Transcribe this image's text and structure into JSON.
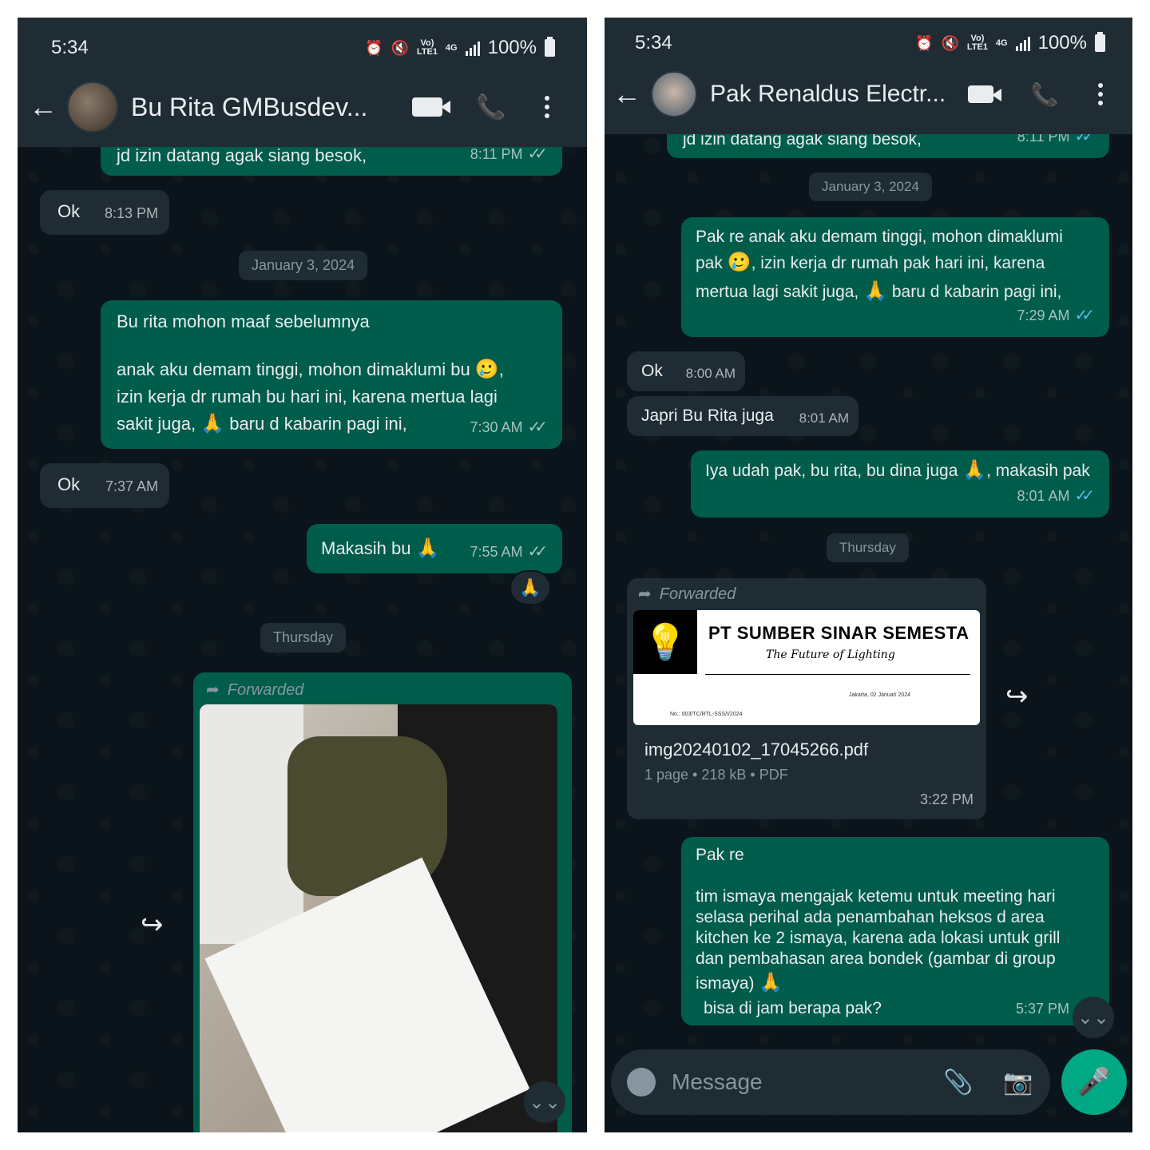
{
  "left": {
    "status_time": "5:34",
    "status_battery": "100%",
    "status_net": "4G",
    "status_volte": "Vo) LTE1",
    "contact_name": "Bu Rita GMBusdev...",
    "messages": {
      "m1_text": "jd izin datang agak siang besok,",
      "m1_time": "8:11 PM",
      "m2_text": "Ok",
      "m2_time": "8:13 PM",
      "date1": "January 3, 2024",
      "m3_line1": "Bu rita mohon maaf sebelumnya",
      "m3_line2a": "anak aku demam tinggi, mohon dimaklumi bu",
      "m3_line3": "izin kerja dr rumah bu hari ini, karena mertua lagi",
      "m3_line4a": "sakit juga,",
      "m3_line4b": "baru d kabarin pagi ini,",
      "m3_time": "7:30 AM",
      "m4_text": "Ok",
      "m4_time": "7:37 AM",
      "m5_text": "Makasih bu",
      "m5_time": "7:55 AM",
      "date2": "Thursday",
      "forwarded": "Forwarded"
    }
  },
  "right": {
    "status_time": "5:34",
    "status_battery": "100%",
    "status_net": "4G",
    "status_volte": "Vo) LTE1",
    "contact_name": "Pak Renaldus Electr...",
    "messages": {
      "m1_text": "jd izin datang agak siang besok,",
      "m1_time": "8:11 PM",
      "date1": "January 3, 2024",
      "m2_line1": "Pak re anak aku demam tinggi, mohon dimaklumi",
      "m2_line2a": "pak",
      "m2_line2b": ", izin kerja dr rumah pak hari ini, karena",
      "m2_line3a": "mertua lagi sakit juga,",
      "m2_line3b": "baru d kabarin pagi ini,",
      "m2_time": "7:29 AM",
      "m3_text": "Ok",
      "m3_time": "8:00 AM",
      "m4_text": "Japri Bu Rita juga",
      "m4_time": "8:01 AM",
      "m5_text_a": "Iya udah pak, bu rita, bu dina juga",
      "m5_text_b": ", makasih pak",
      "m5_time": "8:01 AM",
      "date2": "Thursday",
      "forwarded": "Forwarded",
      "doc_company": "PT SUMBER SINAR SEMESTA",
      "doc_tagline": "The Future of Lighting",
      "doc_place_date": "Jakarta, 02 Januari 2024",
      "doc_number": "No.: 003/TC/RTL-SSS/I/2024",
      "doc_filename": "img20240102_17045266.pdf",
      "doc_meta": "1 page • 218 kB • PDF",
      "doc_time": "3:22 PM",
      "m6_line1": "Pak re",
      "m6_line2": "tim ismaya mengajak ketemu untuk  meeting  hari",
      "m6_line3": "selasa perihal ada penambahan heksos d area",
      "m6_line4": "kitchen ke 2 ismaya, karena ada lokasi untuk grill",
      "m6_line5": "dan pembahasan area bondek  (gambar di group",
      "m6_line6": "ismaya)",
      "m6_line7": "bisa di jam berapa pak?",
      "m6_time": "5:37 PM",
      "composer_placeholder": "Message"
    }
  },
  "icons": {
    "back": "←",
    "pray": "🙏",
    "tear_smile": "🥲",
    "share": "↪",
    "scroll_down": "⌄⌄",
    "clip": "📎",
    "camera": "📷",
    "mic": "🎤",
    "phone": "📞",
    "alarm": "⏰",
    "mute": "🔇"
  },
  "colors": {
    "bg": "#0b141a",
    "header": "#1f2c34",
    "bubble_out": "#005c4b",
    "bubble_in": "#1f2c34",
    "tick_read": "#53bdeb",
    "accent": "#00a884"
  }
}
